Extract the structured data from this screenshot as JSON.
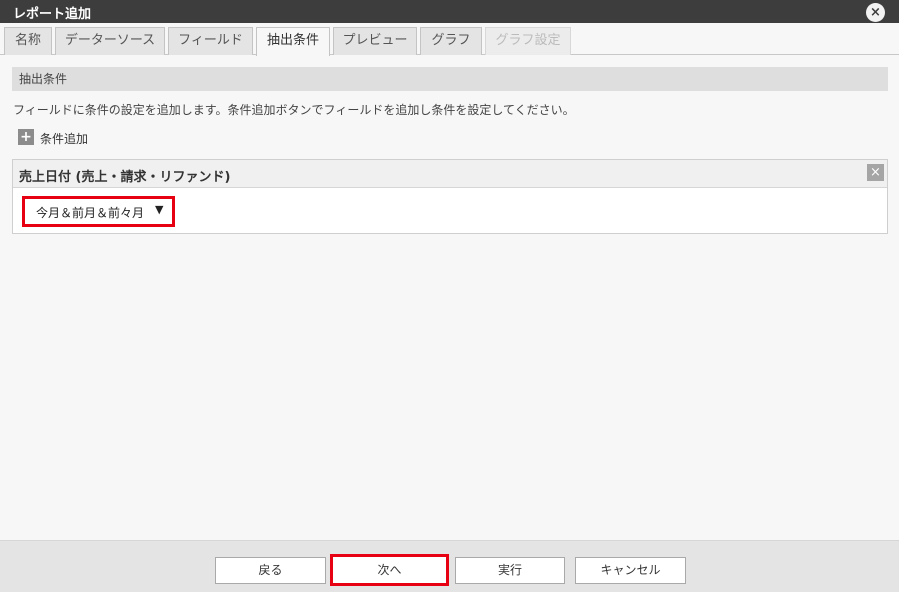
{
  "window": {
    "title": "レポート追加",
    "close_icon": "×"
  },
  "tabs": [
    {
      "label": "名称",
      "state": "normal"
    },
    {
      "label": "データーソース",
      "state": "normal"
    },
    {
      "label": "フィールド",
      "state": "normal"
    },
    {
      "label": "抽出条件",
      "state": "active"
    },
    {
      "label": "プレビュー",
      "state": "normal"
    },
    {
      "label": "グラフ",
      "state": "normal"
    },
    {
      "label": "グラフ設定",
      "state": "disabled"
    }
  ],
  "section": {
    "header": "抽出条件",
    "description": "フィールドに条件の設定を追加します。条件追加ボタンでフィールドを追加し条件を設定してください。",
    "add_icon": "+",
    "add_label": "条件追加"
  },
  "condition": {
    "field_name": "売上日付 (売上・請求・リファンド)",
    "remove_icon": "×",
    "selected_value": "今月＆前月＆前々月",
    "dropdown_icon": "▼"
  },
  "footer": {
    "back_label": "戻る",
    "next_label": "次へ",
    "run_label": "実行",
    "cancel_label": "キャンセル"
  },
  "colors": {
    "titlebar": "#3d3d3d",
    "highlight": "#e60012",
    "section_header": "#dedede"
  }
}
